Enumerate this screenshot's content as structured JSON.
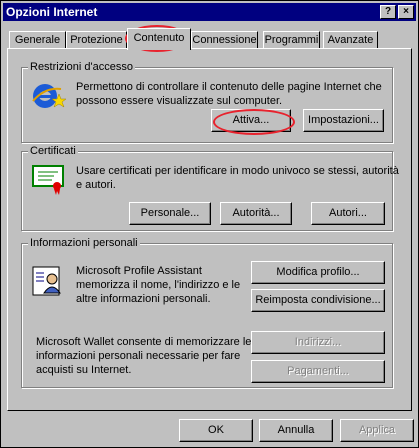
{
  "window": {
    "title": "Opzioni Internet",
    "help_button": "?",
    "close_button": "×"
  },
  "tabs": [
    {
      "label": "Generale"
    },
    {
      "label": "Protezione"
    },
    {
      "label": "Contenuto"
    },
    {
      "label": "Connessione"
    },
    {
      "label": "Programmi"
    },
    {
      "label": "Avanzate"
    }
  ],
  "restrictions": {
    "group_label": "Restrizioni d'accesso",
    "description_line1": "Permettono di controllare il contenuto delle pagine Internet che",
    "description_line2": "possono essere visualizzate sul computer.",
    "enable_button": "Attiva...",
    "settings_button": "Impostazioni..."
  },
  "certificates": {
    "group_label": "Certificati",
    "description_line1": "Usare certificati per identificare in modo univoco se stessi, autorità",
    "description_line2": "e autori.",
    "personal_button": "Personale...",
    "authorities_button": "Autorità...",
    "authors_button": "Autori..."
  },
  "personal_info": {
    "group_label": "Informazioni personali",
    "assistant_line1": "Microsoft Profile Assistant",
    "assistant_line2": "memorizza il nome, l'indirizzo e le",
    "assistant_line3": "altre informazioni personali.",
    "edit_profile_button": "Modifica profilo...",
    "reset_sharing_button": "Reimposta condivisione...",
    "wallet_line1": "Microsoft Wallet consente di memorizzare le",
    "wallet_line2": "informazioni personali necessarie per fare",
    "wallet_line3": "acquisti su Internet.",
    "addresses_button": "Indirizzi...",
    "payments_button": "Pagamenti..."
  },
  "footer": {
    "ok_button": "OK",
    "cancel_button": "Annulla",
    "apply_button": "Applica"
  },
  "colors": {
    "titlebar": "#000080",
    "face": "#c0c0c0",
    "highlight_oval": "#e8222d"
  }
}
